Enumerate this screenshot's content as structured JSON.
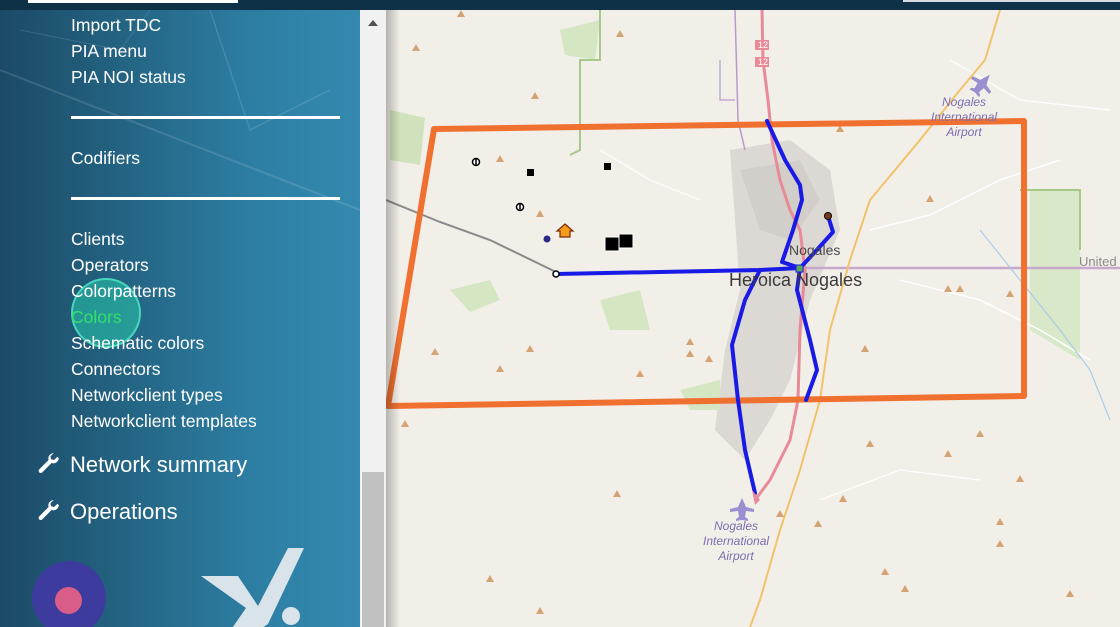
{
  "sidebar": {
    "items_top": [
      "Import TDC",
      "PIA menu",
      "PIA NOI status"
    ],
    "item_codifiers": "Codifiers",
    "items_lists": [
      "Clients",
      "Operators",
      "Colorpatterns",
      "Colors",
      "Schematic colors",
      "Connectors",
      "Networkclient types",
      "Networkclient templates"
    ],
    "active_item": "Colors",
    "sections": [
      "Network summary",
      "Operations"
    ],
    "section_icon": "wrench-icon"
  },
  "map": {
    "labels": {
      "nogales_us": "Nogales",
      "heroica": "Heroica Nogales",
      "airport_top": [
        "Nogales",
        "International",
        "Airport"
      ],
      "airport_bottom": [
        "Nogales",
        "International",
        "Airport"
      ],
      "highway": "12",
      "united": "United"
    }
  },
  "colors": {
    "sidebar": "#246483",
    "boundary": "#f07030",
    "route": "#1a1ae6",
    "active": "#34e06a"
  }
}
